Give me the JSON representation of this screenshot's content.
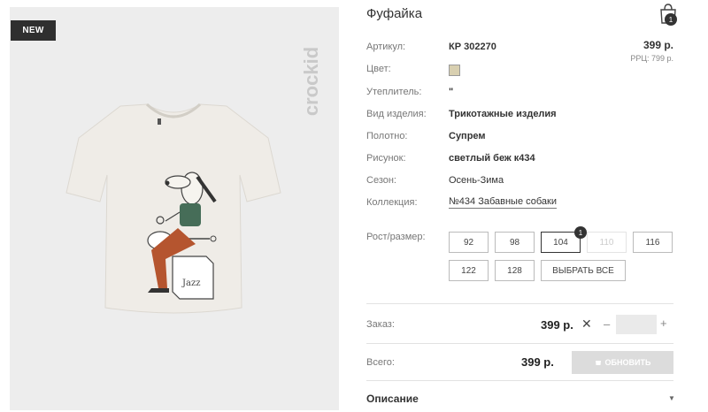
{
  "product": {
    "badge": "NEW",
    "brand_logo_text": "crockid",
    "title": "Фуфайка",
    "cart_count": "1",
    "price": "399 р.",
    "rrc": "РРЦ: 799 р.",
    "color_value": "#d8cfb0"
  },
  "specs": {
    "article_label": "Артикул:",
    "article_value": "КР 302270",
    "color_label": "Цвет:",
    "insulation_label": "Утеплитель:",
    "insulation_value": "\"",
    "type_label": "Вид изделия:",
    "type_value": "Трикотажные изделия",
    "fabric_label": "Полотно:",
    "fabric_value": "Супрем",
    "print_label": "Рисунок:",
    "print_value": "светлый беж к434",
    "season_label": "Сезон:",
    "season_value": "Осень-Зима",
    "collection_label": "Коллекция:",
    "collection_value": "№434 Забавные собаки"
  },
  "sizes": {
    "label": "Рост/размер:",
    "items": [
      "92",
      "98",
      "104",
      "110",
      "116",
      "122",
      "128"
    ],
    "selected": "104",
    "disabled": "110",
    "selected_count": "1",
    "select_all": "ВЫБРАТЬ ВСЕ"
  },
  "order": {
    "label": "Заказ:",
    "price": "399 р.",
    "remove": "✕",
    "minus": "–",
    "plus": "+",
    "quantity": ""
  },
  "total": {
    "label": "Всего:",
    "price": "399 р.",
    "button": "ОБНОВИТЬ"
  },
  "description": {
    "title": "Описание",
    "arrow": "▼"
  },
  "image": {
    "print_caption": "Jazz"
  }
}
